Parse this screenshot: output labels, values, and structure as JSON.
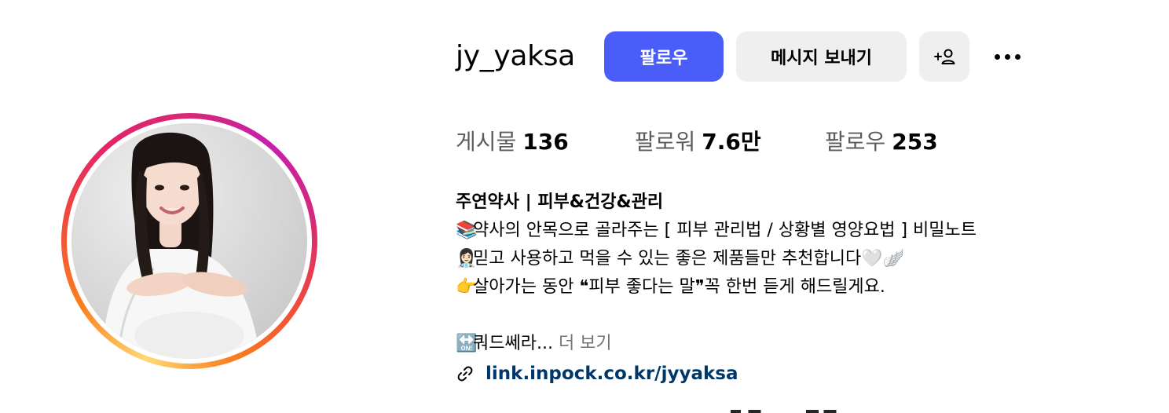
{
  "profile": {
    "username": "jy_yaksa",
    "actions": {
      "follow_label": "팔로우",
      "message_label": "메시지 보내기",
      "add_user_icon": "add-person-icon",
      "more_icon": "more-options-icon"
    },
    "stats": {
      "posts_label": "게시물",
      "posts_value": "136",
      "followers_label": "팔로워",
      "followers_value": "7.6만",
      "following_label": "팔로우",
      "following_value": "253"
    },
    "bio": {
      "name": "주연약사 | 피부&건강&관리",
      "line1_emoji": "📚",
      "line1_text": "약사의 안목으로 골라주는 [ 피부 관리법 / 상황별 영양요법 ] 비밀노트",
      "line2_emoji": "👩🏻‍⚕️",
      "line2_text": "믿고 사용하고 먹을 수 있는 좋은 제품들만 추천합니다",
      "line2_suffix_emoji": "🤍🪽",
      "line3_emoji": "👉",
      "line3_text": "살아가는 동안 ❝피부 좋다는 말❞꼭 한번 듣게 해드릴게요.",
      "line4_emoji": "🔛",
      "line4_text": "쿼드쎄라...",
      "more_label": "더 보기",
      "link_icon": "link-icon",
      "link_text": "link.inpock.co.kr/jyyaksa"
    }
  },
  "colors": {
    "follow_button": "#4a5df9",
    "secondary_button": "#efefef",
    "link": "#00376b",
    "muted_text": "#737373"
  }
}
